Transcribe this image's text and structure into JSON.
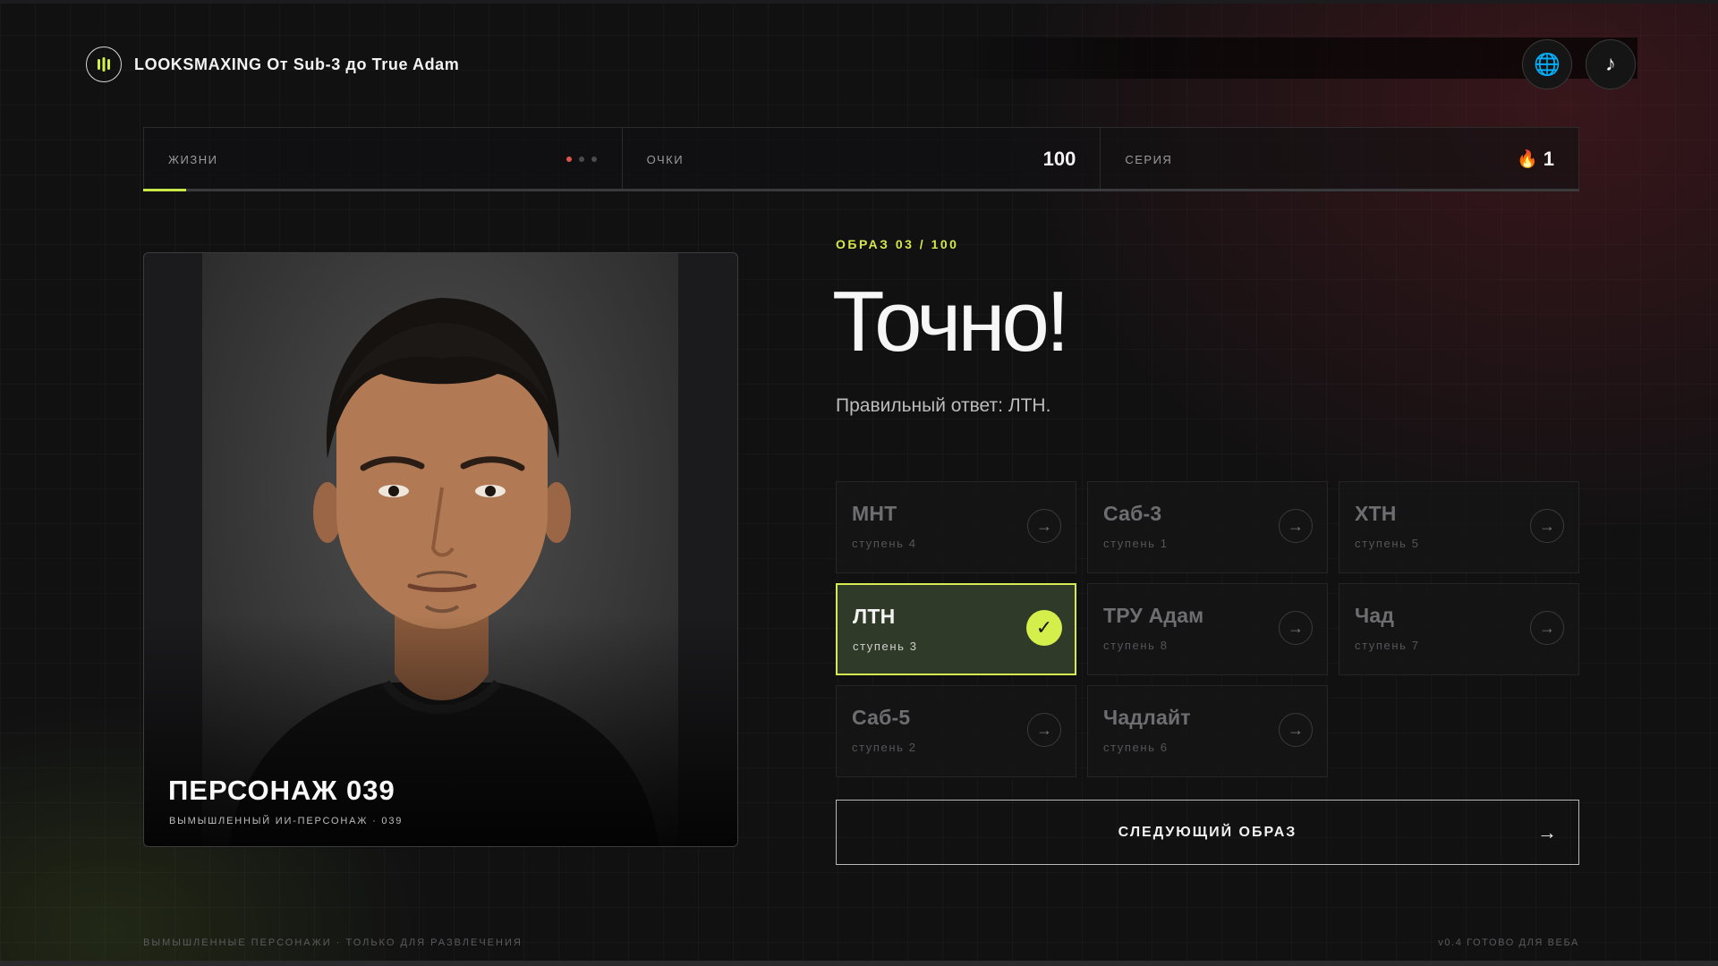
{
  "header": {
    "title": "LOOKSMAXING От Sub-3 до True Adam",
    "logo_icon": "logo-bars-icon",
    "globe_icon": "🌐",
    "music_icon": "♪"
  },
  "stats": {
    "lives_label": "ЖИЗНИ",
    "lives_total": 3,
    "lives_active": 1,
    "points_label": "ОЧКИ",
    "points_value": "100",
    "streak_label": "СЕРИЯ",
    "streak_icon": "🔥",
    "streak_value": "1",
    "progress_fraction": 0.03
  },
  "portrait": {
    "name": "ПЕРСОНАЖ 039",
    "subtitle": "ВЫМЫШЛЕННЫЙ ИИ-ПЕРСОНАЖ · 039"
  },
  "quiz": {
    "round": "ОБРАЗ 03 / 100",
    "result": "Точно!",
    "answer_text": "Правильный ответ: ЛТН.",
    "options": [
      {
        "name": "МНТ",
        "step": "ступень 4",
        "correct": false
      },
      {
        "name": "Саб-3",
        "step": "ступень 1",
        "correct": false
      },
      {
        "name": "ХТН",
        "step": "ступень 5",
        "correct": false
      },
      {
        "name": "ЛТН",
        "step": "ступень 3",
        "correct": true
      },
      {
        "name": "ТРУ Адам",
        "step": "ступень 8",
        "correct": false
      },
      {
        "name": "Чад",
        "step": "ступень 7",
        "correct": false
      },
      {
        "name": "Саб-5",
        "step": "ступень 2",
        "correct": false
      },
      {
        "name": "Чадлайт",
        "step": "ступень 6",
        "correct": false
      }
    ],
    "arrow_glyph": "→",
    "check_glyph": "✓",
    "next_label": "СЛЕДУЮЩИЙ ОБРАЗ",
    "next_arrow": "→"
  },
  "footer": {
    "left": "ВЫМЫШЛЕННЫЕ ПЕРСОНАЖИ · ТОЛЬКО ДЛЯ РАЗВЛЕЧЕНИЯ",
    "right": "v0.4 ГОТОВО ДЛЯ ВЕБА"
  },
  "colors": {
    "accent": "#d4ef4c",
    "danger": "#e0534f",
    "background": "#111112"
  }
}
